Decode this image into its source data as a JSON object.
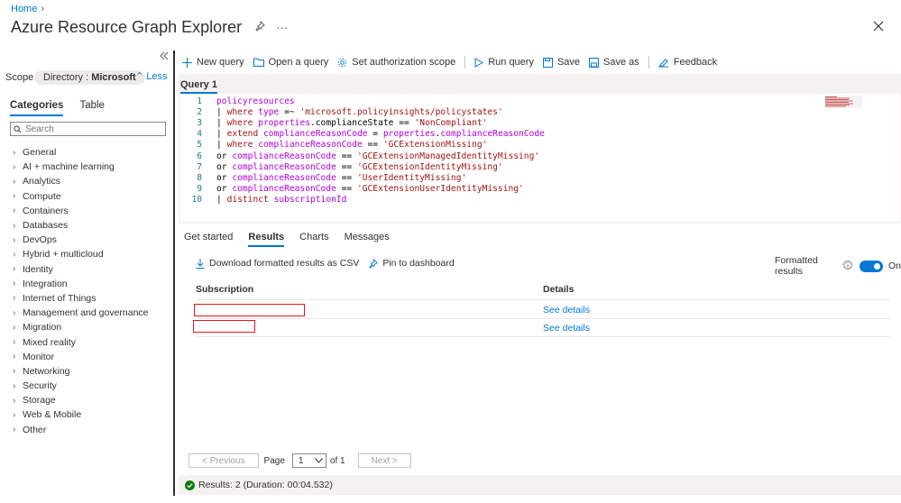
{
  "header": {
    "breadcrumb_home": "Home",
    "title": "Azure Resource Graph Explorer",
    "more_label": "···"
  },
  "left": {
    "scope_label": "Scope",
    "scope_prefix": "Directory : ",
    "scope_value": "Microsoft",
    "less_label": "Less",
    "tabs": [
      "Categories",
      "Table"
    ],
    "search_placeholder": "Search",
    "categories": [
      "General",
      "AI + machine learning",
      "Analytics",
      "Compute",
      "Containers",
      "Databases",
      "DevOps",
      "Hybrid + multicloud",
      "Identity",
      "Integration",
      "Internet of Things",
      "Management and governance",
      "Migration",
      "Mixed reality",
      "Monitor",
      "Networking",
      "Security",
      "Storage",
      "Web & Mobile",
      "Other"
    ]
  },
  "toolbar": {
    "new_query": "New query",
    "open_query": "Open a query",
    "set_auth_scope": "Set authorization scope",
    "run_query": "Run query",
    "save": "Save",
    "save_as": "Save as",
    "feedback": "Feedback"
  },
  "editor": {
    "tab_label": "Query 1",
    "lines": [
      {
        "n": "1",
        "text": "policyresources"
      },
      {
        "n": "2",
        "text": "| where type =~ 'microsoft.policyinsights/policystates'"
      },
      {
        "n": "3",
        "text": "| where properties.complianceState == 'NonCompliant'"
      },
      {
        "n": "4",
        "text": "| extend complianceReasonCode = properties.complianceReasonCode"
      },
      {
        "n": "5",
        "text": "| where complianceReasonCode == 'GCExtensionMissing'"
      },
      {
        "n": "6",
        "text": "or complianceReasonCode == 'GCExtensionManagedIdentityMissing'"
      },
      {
        "n": "7",
        "text": "or complianceReasonCode == 'GCExtensionIdentityMissing'"
      },
      {
        "n": "8",
        "text": "or complianceReasonCode == 'UserIdentityMissing'"
      },
      {
        "n": "9",
        "text": "or complianceReasonCode == 'GCExtensionUserIdentityMissing'"
      },
      {
        "n": "10",
        "text": "| distinct subscriptionId"
      }
    ]
  },
  "results": {
    "tabs": [
      "Get started",
      "Results",
      "Charts",
      "Messages"
    ],
    "active_tab": "Results",
    "download_csv": "Download formatted results as CSV",
    "pin_dashboard": "Pin to dashboard",
    "formatted_label": "Formatted results",
    "toggle_state": "On",
    "columns": [
      "Subscription",
      "Details"
    ],
    "rows": [
      {
        "subscription": "",
        "details": "See details"
      },
      {
        "subscription": "",
        "details": "See details"
      }
    ],
    "pager": {
      "previous": "< Previous",
      "page_label": "Page",
      "page_value": "1",
      "of_label": "of 1",
      "next": "Next >"
    },
    "status": "Results: 2 (Duration: 00:04.532)"
  },
  "colors": {
    "accent": "#0078d4",
    "success": "#107c10",
    "redaction": "#e81123"
  }
}
